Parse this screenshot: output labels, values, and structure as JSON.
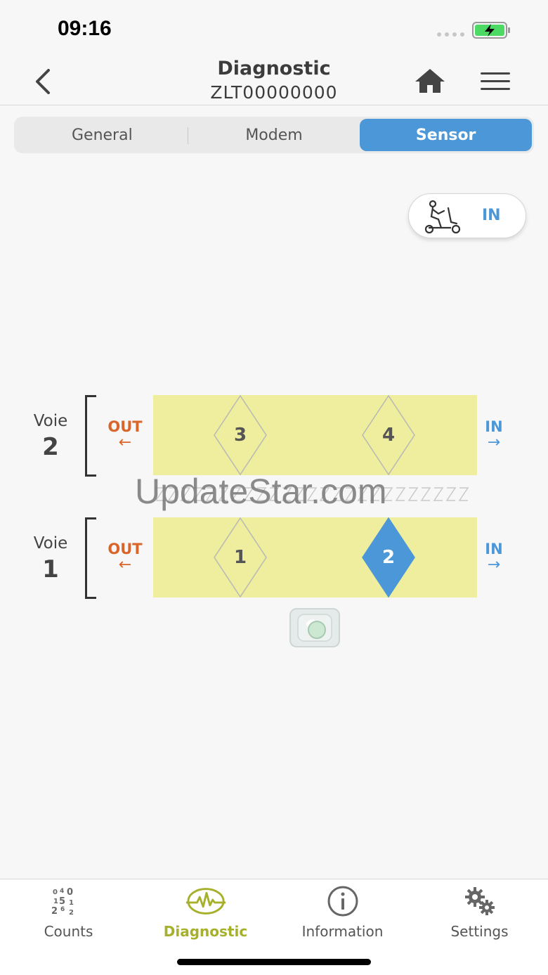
{
  "status_bar": {
    "time": "09:16"
  },
  "nav": {
    "title": "Diagnostic",
    "subtitle": "ZLT00000000",
    "icons": {
      "back": "chevron-left-icon",
      "home": "home-icon",
      "menu": "hamburger-menu-icon"
    }
  },
  "segments": [
    {
      "label": "General",
      "active": false
    },
    {
      "label": "Modem",
      "active": false
    },
    {
      "label": "Sensor",
      "active": true
    }
  ],
  "direction_toggle": {
    "icon": "scooter-icon",
    "label": "IN"
  },
  "lanes": [
    {
      "voie_label": "Voie",
      "number": "2",
      "out_label": "OUT",
      "in_label": "IN",
      "out_arrow": "←",
      "in_arrow": "→",
      "sensors": [
        {
          "label": "3",
          "active": false
        },
        {
          "label": "4",
          "active": false
        }
      ]
    },
    {
      "voie_label": "Voie",
      "number": "1",
      "out_label": "OUT",
      "in_label": "IN",
      "out_arrow": "←",
      "in_arrow": "→",
      "sensors": [
        {
          "label": "1",
          "active": false
        },
        {
          "label": "2",
          "active": true
        }
      ]
    }
  ],
  "watermark": "UpdateStar.com",
  "calibrate_button": {
    "icon": "camera-lens-icon"
  },
  "tabs": [
    {
      "label": "Counts",
      "icon": "counts-icon",
      "active": false
    },
    {
      "label": "Diagnostic",
      "icon": "diagnostic-pulse-icon",
      "active": true
    },
    {
      "label": "Information",
      "icon": "info-icon",
      "active": false
    },
    {
      "label": "Settings",
      "icon": "gears-icon",
      "active": false
    }
  ],
  "colors": {
    "accent_blue": "#4b97d8",
    "out_orange": "#d9652a",
    "lane_yellow": "#eeee9e",
    "tab_active": "#a6b02a"
  }
}
